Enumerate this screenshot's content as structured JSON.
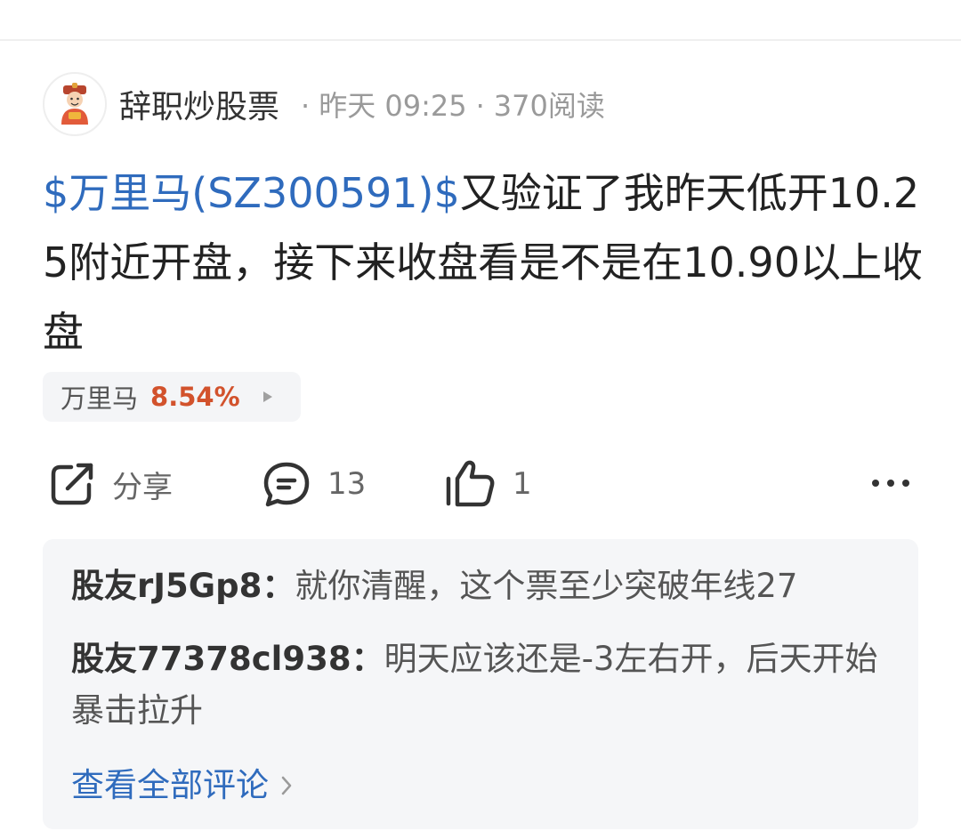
{
  "post": {
    "author": "辞职炒股票",
    "separator": "·",
    "time": "昨天 09:25",
    "reads": "370阅读",
    "stock_tag": "$万里马(SZ300591)$",
    "text": "又验证了我昨天低开10.25附近开盘，接下来收盘看是不是在10.90以上收盘"
  },
  "stock_chip": {
    "name": "万里马",
    "change": "8.54%",
    "arrow_icon": "play-triangle-icon",
    "change_color": "#d2522c"
  },
  "actions": {
    "share_label": "分享",
    "comment_count": "13",
    "like_count": "1"
  },
  "comments": [
    {
      "user": "股友rJ5Gp8：",
      "text": "就你清醒，这个票至少突破年线27"
    },
    {
      "user": "股友77378cl938：",
      "text": "明天应该还是-3左右开，后天开始暴击拉升"
    }
  ],
  "view_all": "查看全部评论",
  "colors": {
    "link_blue": "#2f6bbd",
    "up_red": "#d2522c",
    "comment_bg": "#f5f6f8"
  }
}
